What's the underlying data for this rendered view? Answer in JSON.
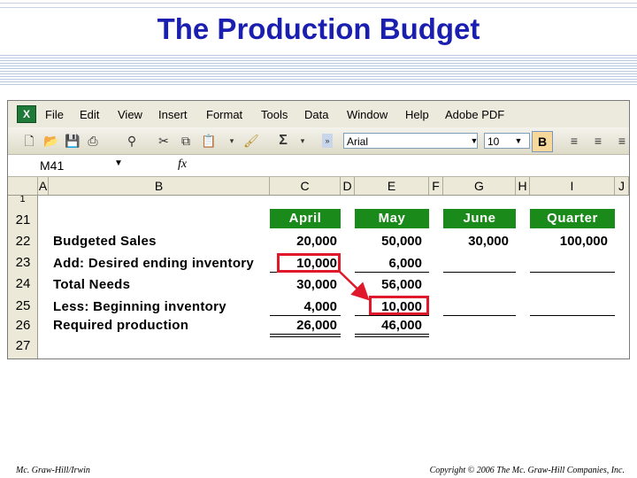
{
  "slide": {
    "title": "The Production Budget",
    "footer_left": "Mc. Graw-Hill/Irwin",
    "footer_right": "Copyright © 2006 The Mc. Graw-Hill Companies, Inc."
  },
  "excel": {
    "menu": [
      "File",
      "Edit",
      "View",
      "Insert",
      "Format",
      "Tools",
      "Data",
      "Window",
      "Help",
      "Adobe PDF"
    ],
    "toolbar": {
      "font_name": "Arial",
      "font_size": "10",
      "bold_label": "B",
      "sigma": "Σ",
      "icons": [
        "new-icon",
        "open-icon",
        "save-icon",
        "print-icon",
        "research-icon",
        "cut-icon",
        "copy-icon",
        "paste-icon",
        "format-painter-icon",
        "autosum-icon",
        "align-left-icon",
        "align-center-icon",
        "align-right-icon"
      ]
    },
    "name_box": "M41",
    "fx_label": "fx",
    "columns": [
      "A",
      "B",
      "C",
      "D",
      "E",
      "F",
      "G",
      "H",
      "I",
      "J"
    ],
    "partial_row": "1",
    "rows": [
      "21",
      "22",
      "23",
      "24",
      "25",
      "26",
      "27"
    ],
    "headers": [
      "April",
      "May",
      "June",
      "Quarter"
    ],
    "labels": [
      "Budgeted Sales",
      "Add: Desired ending inventory",
      "Total Needs",
      "Less: Beginning inventory",
      "Required production"
    ],
    "values": {
      "budgeted_sales": [
        "20,000",
        "50,000",
        "30,000",
        "100,000"
      ],
      "desired_ending": [
        "10,000",
        "6,000"
      ],
      "total_needs": [
        "30,000",
        "56,000"
      ],
      "beginning_inv": [
        "4,000",
        "10,000"
      ],
      "required_prod": [
        "26,000",
        "46,000"
      ]
    },
    "highlight_color": "#e0182b",
    "header_color": "#1a8a1a"
  }
}
